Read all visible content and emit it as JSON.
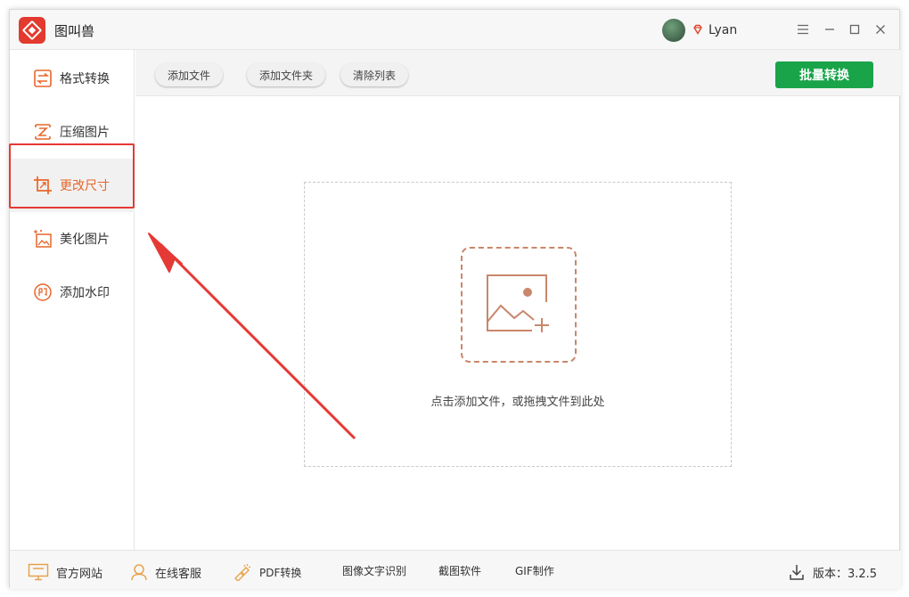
{
  "app": {
    "title": "图叫兽",
    "user": {
      "name": "Lyan"
    }
  },
  "sidebar": {
    "items": [
      {
        "label": "格式转换",
        "icon": "format-convert-icon",
        "active": false
      },
      {
        "label": "压缩图片",
        "icon": "compress-icon",
        "active": false
      },
      {
        "label": "更改尺寸",
        "icon": "resize-crop-icon",
        "active": true
      },
      {
        "label": "美化图片",
        "icon": "beautify-icon",
        "active": false
      },
      {
        "label": "添加水印",
        "icon": "watermark-icon",
        "active": false
      }
    ]
  },
  "toolbar": {
    "add_file": "添加文件",
    "add_folder": "添加文件夹",
    "clear_list": "清除列表",
    "batch_convert": "批量转换"
  },
  "dropzone": {
    "hint": "点击添加文件，或拖拽文件到此处"
  },
  "statusbar": {
    "website": "官方网站",
    "support": "在线客服",
    "pdf": "PDF转换",
    "ocr": "图像文字识别",
    "screenshot": "截图软件",
    "gif": "GIF制作",
    "version": "版本：3.2.5"
  },
  "colors": {
    "accent": "#e8662a",
    "primary_button": "#19a44a",
    "annotation": "#e53935",
    "logo": "#e23a2e"
  }
}
